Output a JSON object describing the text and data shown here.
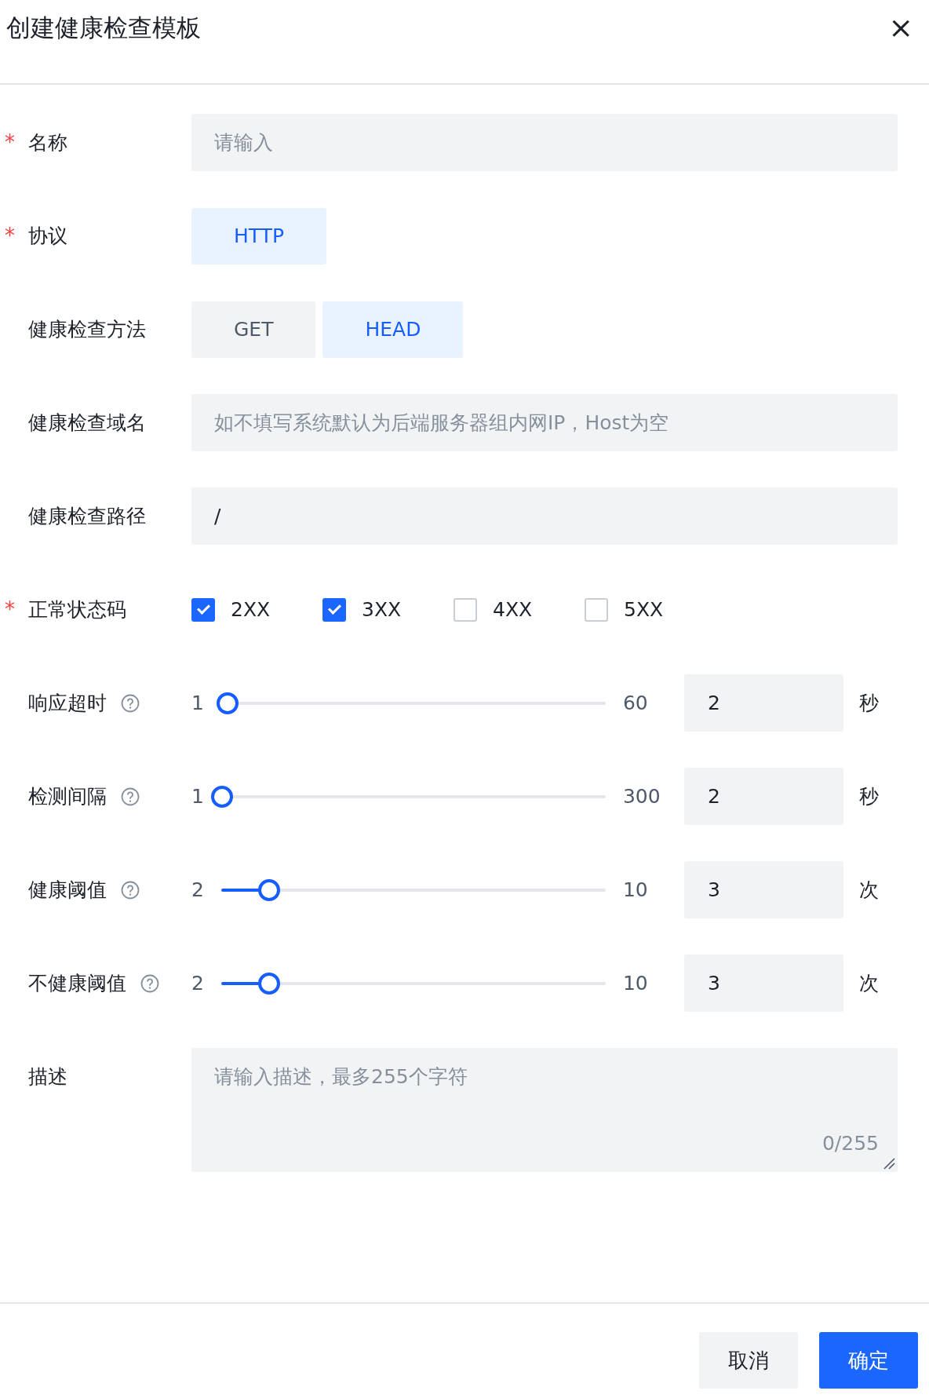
{
  "dialog": {
    "title": "创建健康检查模板",
    "close": "×"
  },
  "fields": [
    {
      "kind": "text",
      "label": "名称",
      "required_mark": "*",
      "placeholder": "请输入"
    },
    {
      "kind": "segmented",
      "label": "协议",
      "required_mark": "*",
      "options": [
        {
          "label": "HTTP",
          "selected": true
        }
      ]
    },
    {
      "kind": "segmented",
      "label": "健康检查方法",
      "options": [
        {
          "label": "GET",
          "selected": false
        },
        {
          "label": "HEAD",
          "selected": true
        }
      ]
    },
    {
      "kind": "text",
      "label": "健康检查域名",
      "placeholder": "如不填写系统默认为后端服务器组内网IP，Host为空"
    },
    {
      "kind": "text",
      "label": "健康检查路径",
      "value": "/"
    },
    {
      "kind": "checkboxes",
      "label": "正常状态码",
      "required_mark": "*",
      "options": [
        {
          "label": "2XX",
          "checked": true
        },
        {
          "label": "3XX",
          "checked": true
        },
        {
          "label": "4XX",
          "checked": false
        },
        {
          "label": "5XX",
          "checked": false
        }
      ]
    },
    {
      "kind": "slider",
      "label": "响应超时",
      "help": true,
      "min": "1",
      "max": "60",
      "level": 0.017,
      "value": "2",
      "unit": "秒"
    },
    {
      "kind": "slider",
      "label": "检测间隔",
      "help": true,
      "min": "1",
      "max": "300",
      "level": 0.003,
      "value": "2",
      "unit": "秒"
    },
    {
      "kind": "slider",
      "label": "健康阈值",
      "help": true,
      "min": "2",
      "max": "10",
      "level": 0.125,
      "value": "3",
      "unit": "次"
    },
    {
      "kind": "slider",
      "label": "不健康阈值",
      "help": true,
      "min": "2",
      "max": "10",
      "level": 0.125,
      "value": "3",
      "unit": "次"
    },
    {
      "kind": "textarea",
      "label": "描述",
      "placeholder": "请输入描述，最多255个字符",
      "counter": "0/255"
    }
  ],
  "buttons": [
    {
      "label": "取消",
      "primary": false
    },
    {
      "label": "确定",
      "primary": true
    }
  ]
}
